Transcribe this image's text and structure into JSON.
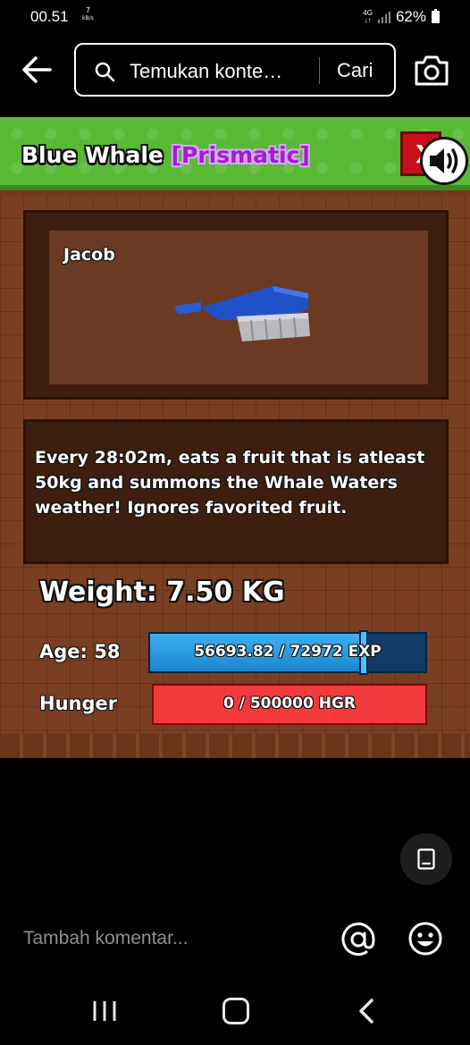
{
  "status_bar": {
    "time": "00.51",
    "speed_value": "7",
    "speed_unit": "kB/s",
    "network_type": "4G",
    "battery": "62%"
  },
  "search": {
    "query": "Temukan konte…",
    "submit_label": "Cari"
  },
  "video": {
    "pet_title": "Blue Whale",
    "pet_variant": "[Prismatic]",
    "close_label": "X",
    "pet_name": "Jacob",
    "description": "Every 28:02m, eats a fruit that is atleast 50kg and summons the Whale Waters weather! Ignores favorited fruit.",
    "weight": "Weight: 7.50 KG",
    "age": "Age: 58",
    "exp_text": "56693.82 / 72972 EXP",
    "exp_fraction": 0.777,
    "hunger_label": "Hunger",
    "hunger_text": "0 / 500000 HGR",
    "hunger_fraction": 0.0
  },
  "comment": {
    "placeholder": "Tambah komentar..."
  },
  "icons": {
    "back": "arrow-left-icon",
    "search": "search-icon",
    "camera": "camera-icon",
    "sound": "speaker-icon",
    "document": "document-icon",
    "mention": "at-sign-icon",
    "emoji": "emoji-icon"
  }
}
